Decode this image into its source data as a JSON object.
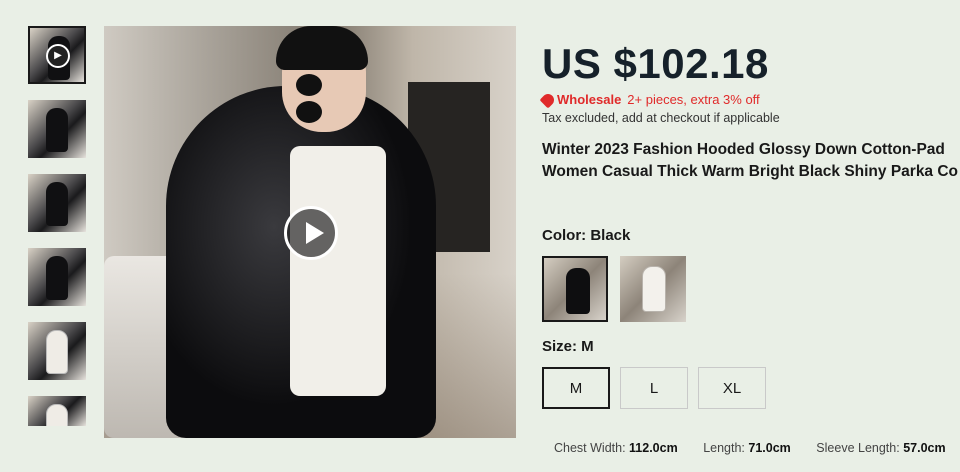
{
  "thumbnails": [
    {
      "name": "video-thumbnail",
      "has_play": true,
      "variant": "dark"
    },
    {
      "name": "thumb-2",
      "variant": "dark"
    },
    {
      "name": "thumb-3",
      "variant": "dark"
    },
    {
      "name": "thumb-4",
      "variant": "dark"
    },
    {
      "name": "thumb-5",
      "variant": "light"
    },
    {
      "name": "thumb-6",
      "variant": "light"
    }
  ],
  "product": {
    "price": "US $102.18",
    "wholesale_label": "Wholesale",
    "wholesale_offer": "2+ pieces, extra 3% off",
    "tax_note": "Tax excluded, add at checkout if applicable",
    "title_line1": "Winter 2023 Fashion Hooded Glossy Down Cotton-Pad",
    "title_line2": "Women Casual Thick Warm Bright Black Shiny Parka Co"
  },
  "color": {
    "label": "Color: Black",
    "options": [
      "Black",
      "White"
    ],
    "selected": "Black"
  },
  "size": {
    "label": "Size: M",
    "options": [
      "M",
      "L",
      "XL"
    ],
    "selected": "M"
  },
  "measurements": {
    "chest_label": "Chest Width:",
    "chest_value": "112.0cm",
    "length_label": "Length:",
    "length_value": "71.0cm",
    "sleeve_label": "Sleeve Length:",
    "sleeve_value": "57.0cm"
  },
  "colors": {
    "accent_red": "#e02a2a",
    "price_text": "#16212a",
    "background": "#e9efe6"
  }
}
